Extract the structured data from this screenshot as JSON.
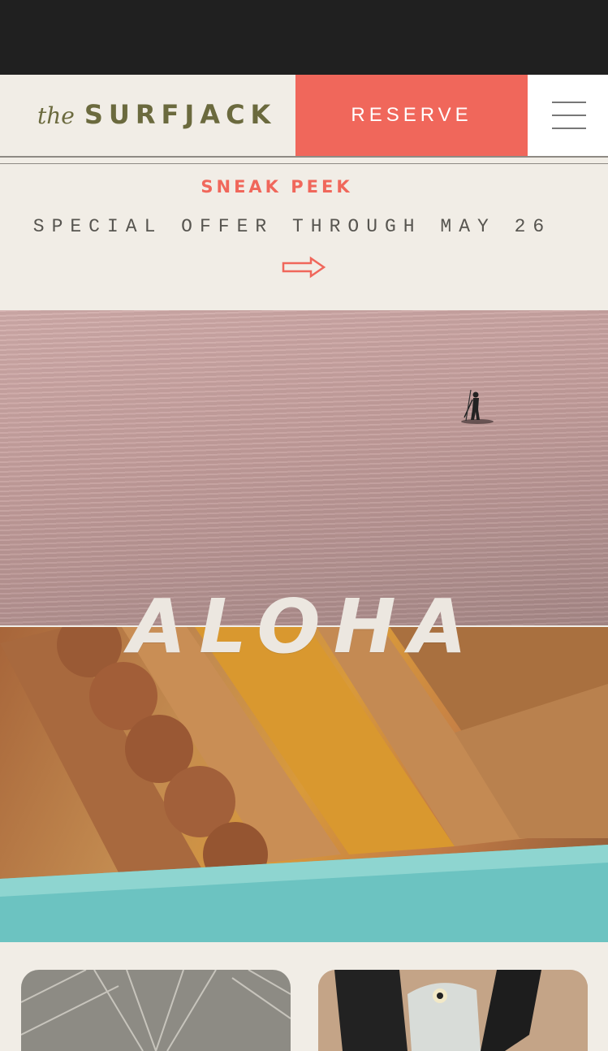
{
  "header": {
    "logo_prefix": "the",
    "logo_name": "SURFJACK",
    "reserve_label": "RESERVE"
  },
  "promo": {
    "eyebrow": "SNEAK PEEK",
    "headline": "SPECIAL OFFER THROUGH MAY 26"
  },
  "hero": {
    "overlay_text": "ALOHA"
  },
  "icons": {
    "menu": "hamburger-menu-icon",
    "arrow": "arrow-right-icon"
  },
  "colors": {
    "accent": "#f0675b",
    "logo": "#6b6a3e",
    "topbar": "#202020",
    "page": "#f1ede6"
  }
}
